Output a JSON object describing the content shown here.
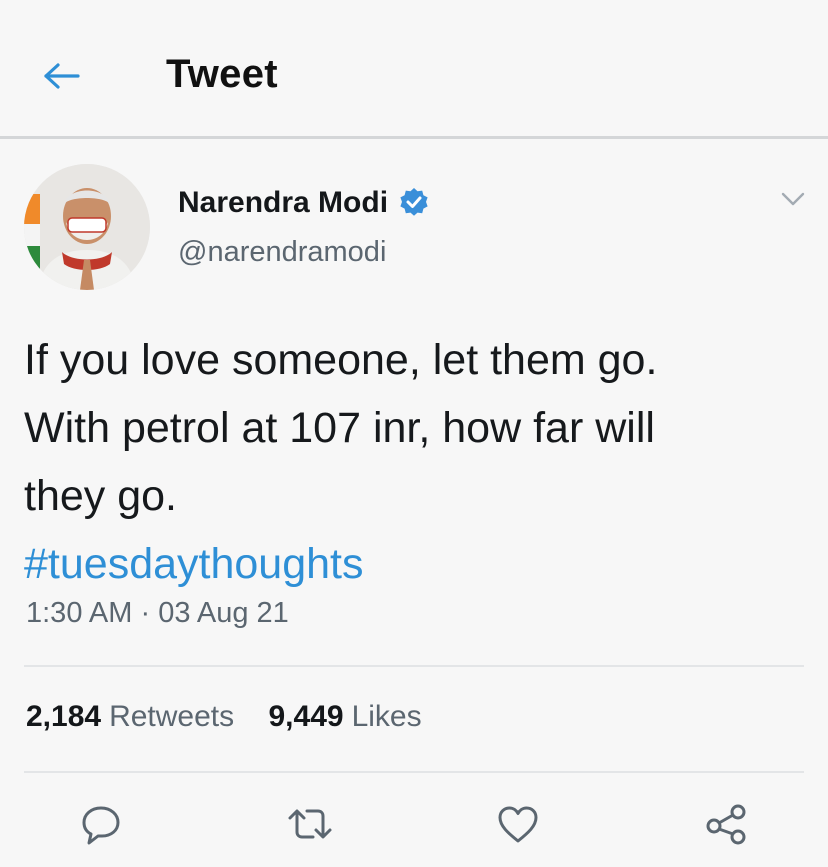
{
  "header": {
    "title": "Tweet",
    "back_icon": "arrow-left-icon",
    "accent_color": "#2e8fd6"
  },
  "author": {
    "display_name": "Narendra Modi",
    "handle": "@narendramodi",
    "verified": true,
    "verified_color": "#3a8fd9"
  },
  "tweet": {
    "text": "If you love someone, let them go.\nWith petrol at 107 inr, how far will\nthey go.",
    "hashtag": "#tuesdaythoughts",
    "time": "1:30 AM",
    "separator": " · ",
    "date": "03 Aug 21"
  },
  "stats": {
    "retweets_count": "2,184",
    "retweets_label": "Retweets",
    "likes_count": "9,449",
    "likes_label": "Likes"
  },
  "actions": [
    {
      "name": "reply",
      "icon": "speech-bubble-icon"
    },
    {
      "name": "retweet",
      "icon": "retweet-arrows-icon"
    },
    {
      "name": "like",
      "icon": "heart-icon"
    },
    {
      "name": "share",
      "icon": "share-nodes-icon"
    }
  ]
}
